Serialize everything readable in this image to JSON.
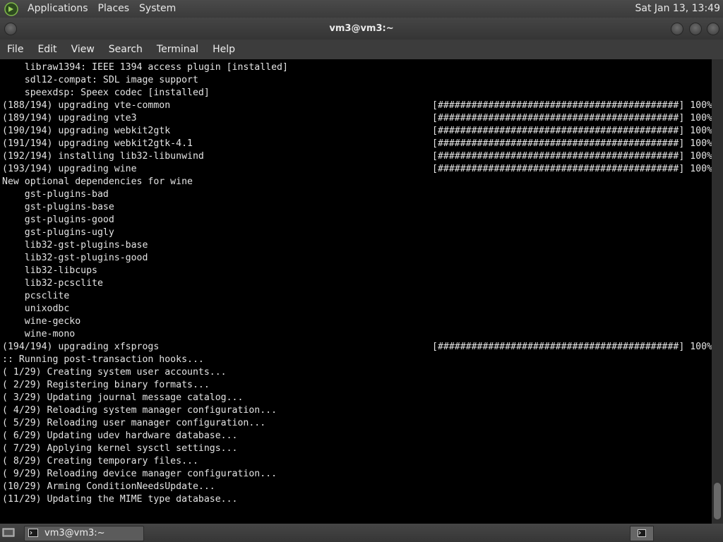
{
  "top_panel": {
    "menus": [
      "Applications",
      "Places",
      "System"
    ],
    "clock": "Sat Jan 13, 13:49"
  },
  "window": {
    "title": "vm3@vm3:~"
  },
  "menubar": [
    "File",
    "Edit",
    "View",
    "Search",
    "Terminal",
    "Help"
  ],
  "terminal": {
    "lines": [
      {
        "text": "    libraw1394: IEEE 1394 access plugin [installed]"
      },
      {
        "text": "    sdl12-compat: SDL image support"
      },
      {
        "text": "    speexdsp: Speex codec [installed]"
      },
      {
        "text": "(188/194) upgrading vte-common",
        "bar": "[###########################################] 100%",
        "percent": 100
      },
      {
        "text": "(189/194) upgrading vte3",
        "bar": "[###########################################] 100%",
        "percent": 100
      },
      {
        "text": "(190/194) upgrading webkit2gtk",
        "bar": "[###########################################] 100%",
        "percent": 100
      },
      {
        "text": "(191/194) upgrading webkit2gtk-4.1",
        "bar": "[###########################################] 100%",
        "percent": 100
      },
      {
        "text": "(192/194) installing lib32-libunwind",
        "bar": "[###########################################] 100%",
        "percent": 100
      },
      {
        "text": "(193/194) upgrading wine",
        "bar": "[###########################################] 100%",
        "percent": 100
      },
      {
        "text": "New optional dependencies for wine"
      },
      {
        "text": "    gst-plugins-bad"
      },
      {
        "text": "    gst-plugins-base"
      },
      {
        "text": "    gst-plugins-good"
      },
      {
        "text": "    gst-plugins-ugly"
      },
      {
        "text": "    lib32-gst-plugins-base"
      },
      {
        "text": "    lib32-gst-plugins-good"
      },
      {
        "text": "    lib32-libcups"
      },
      {
        "text": "    lib32-pcsclite"
      },
      {
        "text": "    pcsclite"
      },
      {
        "text": "    unixodbc"
      },
      {
        "text": "    wine-gecko"
      },
      {
        "text": "    wine-mono"
      },
      {
        "text": "(194/194) upgrading xfsprogs",
        "bar": "[###########################################] 100%",
        "percent": 100
      },
      {
        "text": ":: Running post-transaction hooks..."
      },
      {
        "text": "( 1/29) Creating system user accounts..."
      },
      {
        "text": "( 2/29) Registering binary formats..."
      },
      {
        "text": "( 3/29) Updating journal message catalog..."
      },
      {
        "text": "( 4/29) Reloading system manager configuration..."
      },
      {
        "text": "( 5/29) Reloading user manager configuration..."
      },
      {
        "text": "( 6/29) Updating udev hardware database..."
      },
      {
        "text": "( 7/29) Applying kernel sysctl settings..."
      },
      {
        "text": "( 8/29) Creating temporary files..."
      },
      {
        "text": "( 9/29) Reloading device manager configuration..."
      },
      {
        "text": "(10/29) Arming ConditionNeedsUpdate..."
      },
      {
        "text": "(11/29) Updating the MIME type database..."
      }
    ]
  },
  "taskbar": {
    "task_label": "vm3@vm3:~"
  },
  "icons": {
    "logo": "mate-logo-icon",
    "show_desktop": "show-desktop-icon",
    "task": "terminal-icon",
    "workspace": "workspace-switcher-icon"
  }
}
